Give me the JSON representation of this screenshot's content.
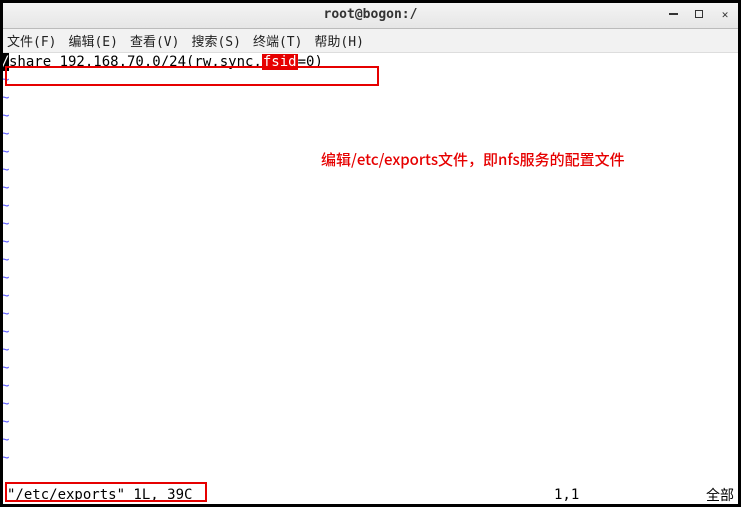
{
  "window": {
    "title": "root@bogon:/"
  },
  "menu": {
    "file": "文件(F)",
    "edit": "编辑(E)",
    "view": "查看(V)",
    "search": "搜索(S)",
    "terminal": "终端(T)",
    "help": "帮助(H)"
  },
  "editor": {
    "line1_prefix": "/",
    "line1_text_a": "share 192.168.70.0/24(rw,sync,",
    "line1_fsid": "fsid",
    "line1_text_b": "=0)",
    "tilde": "~"
  },
  "annotation": {
    "text": "编辑/etc/exports文件，即nfs服务的配置文件"
  },
  "status": {
    "left": "\"/etc/exports\" 1L, 39C",
    "position": "1,1",
    "right": "全部"
  }
}
